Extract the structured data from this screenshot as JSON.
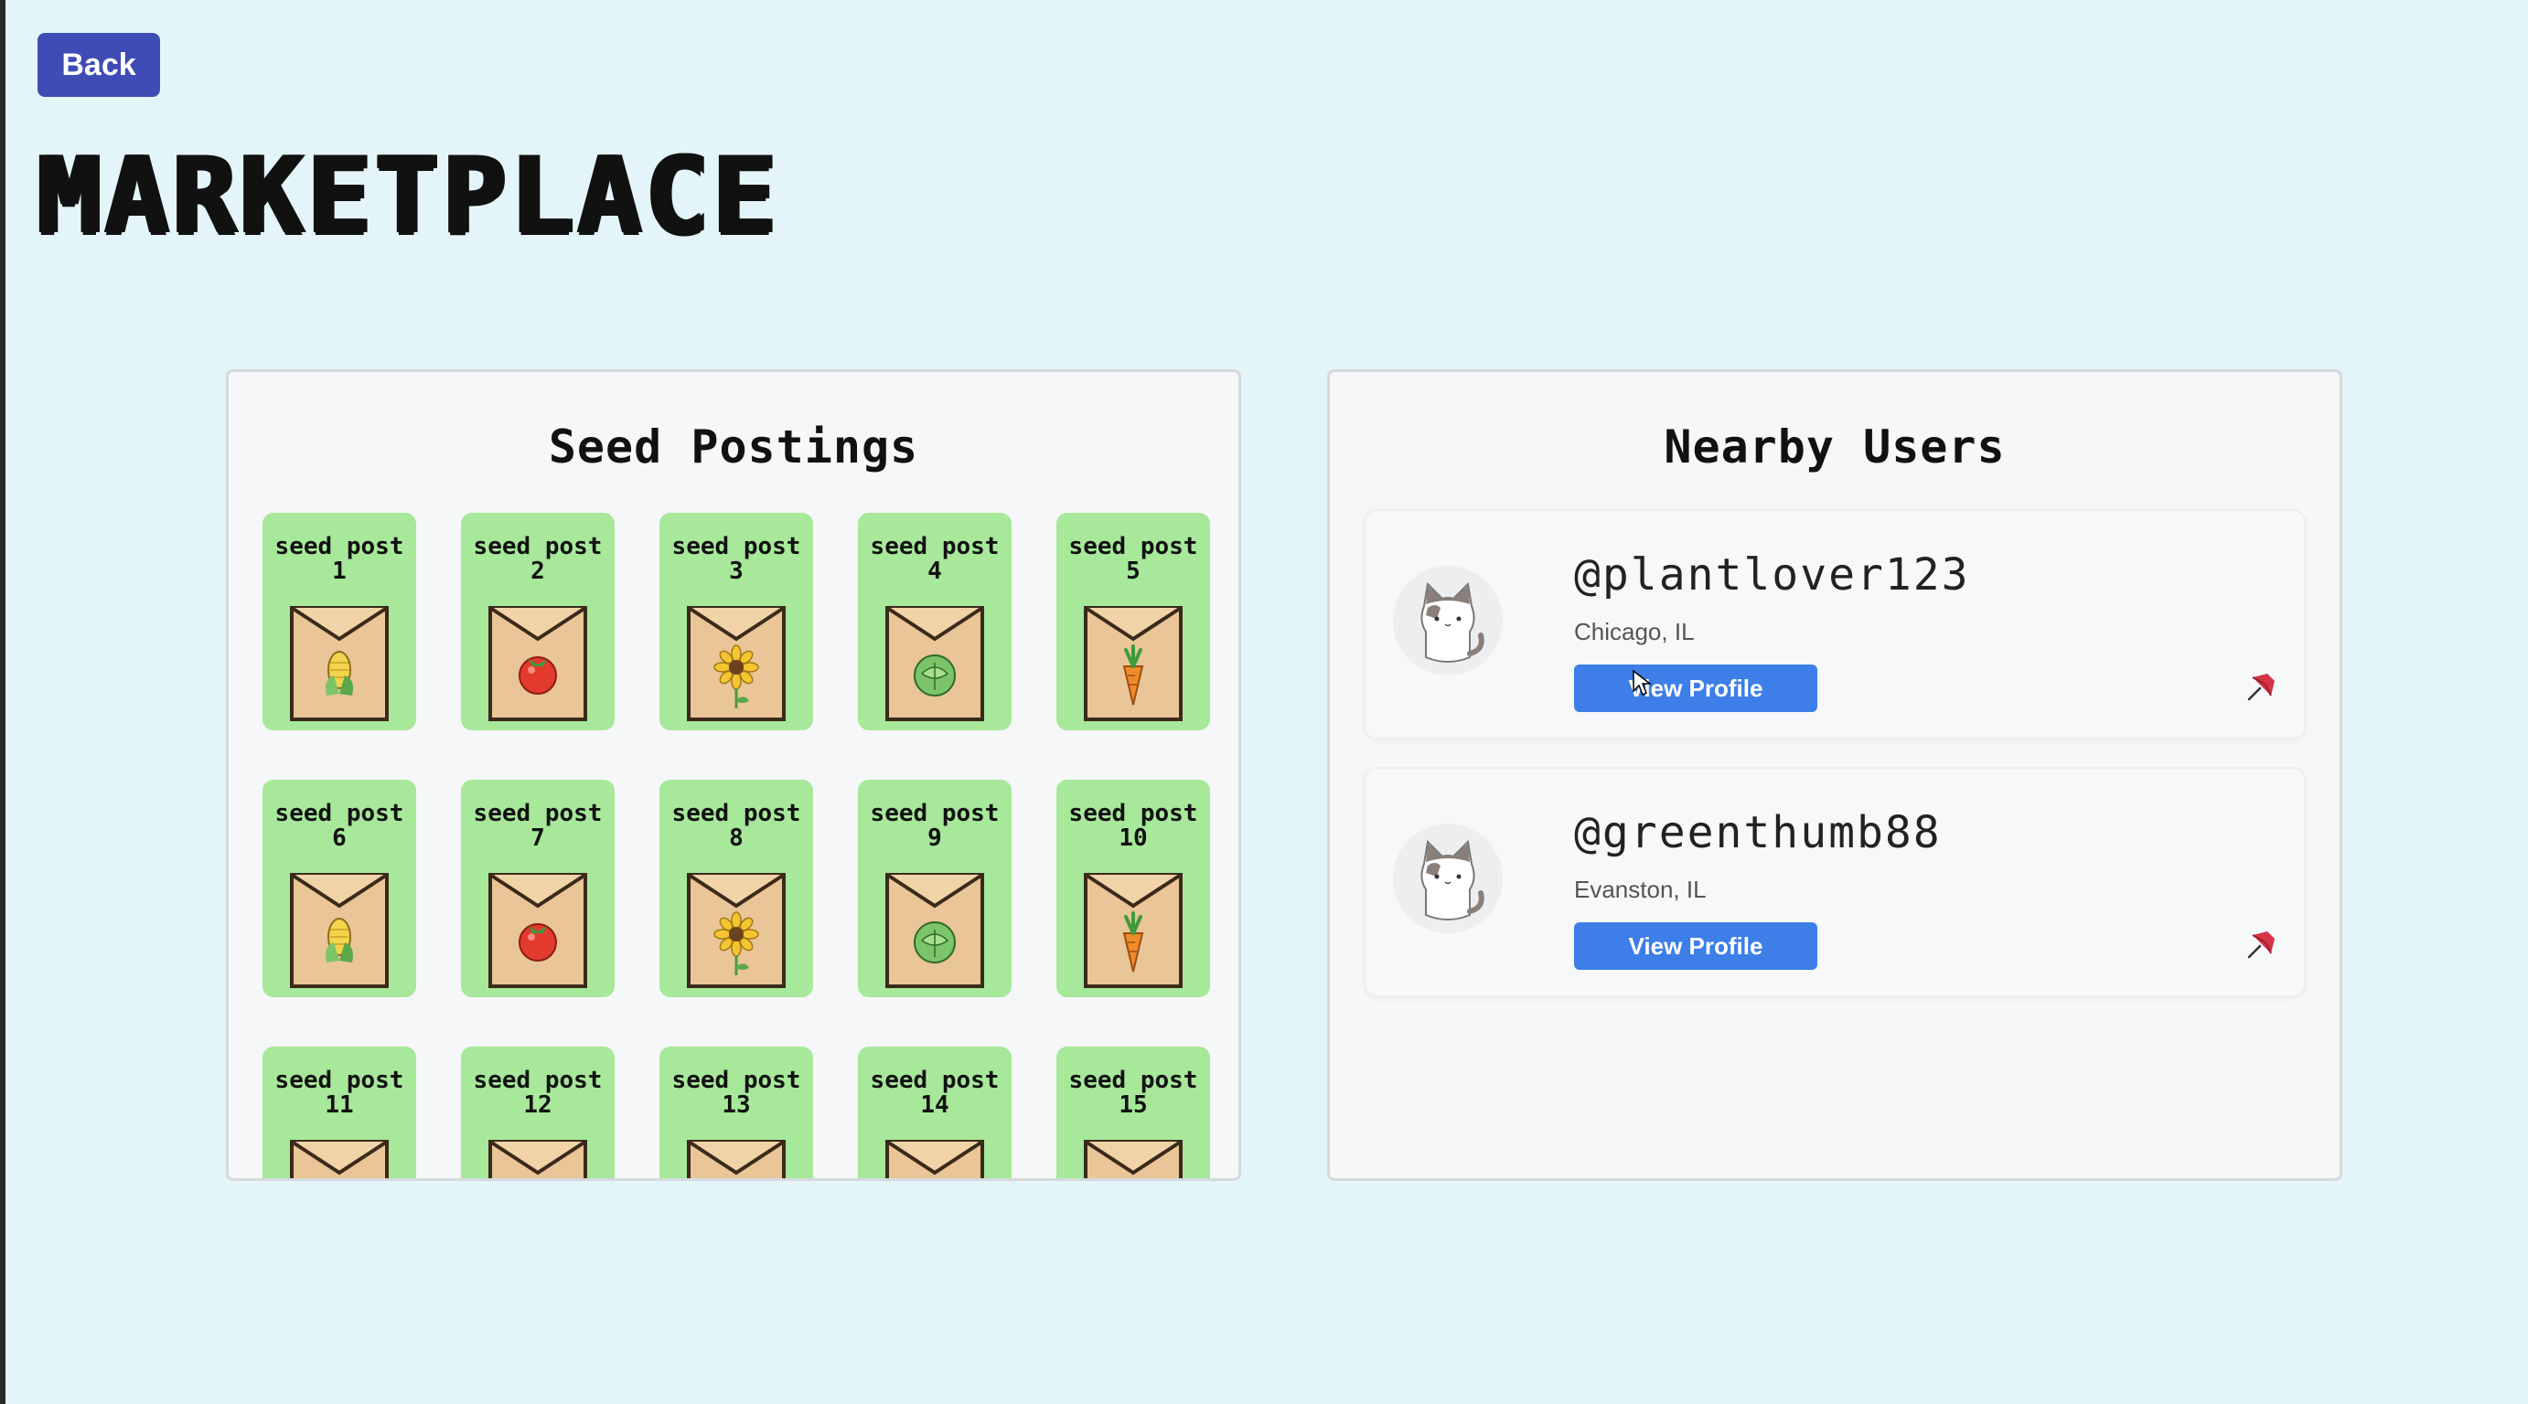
{
  "header": {
    "back_label": "Back",
    "title": "Marketplace"
  },
  "seed_postings": {
    "title": "Seed Postings",
    "card_color": "#a7e89a",
    "items": [
      {
        "label": "seed post 1",
        "icon": "corn-icon"
      },
      {
        "label": "seed post 2",
        "icon": "tomato-icon"
      },
      {
        "label": "seed post 3",
        "icon": "sunflower-icon"
      },
      {
        "label": "seed post 4",
        "icon": "cabbage-icon"
      },
      {
        "label": "seed post 5",
        "icon": "carrot-icon"
      },
      {
        "label": "seed post 6",
        "icon": "corn-icon"
      },
      {
        "label": "seed post 7",
        "icon": "tomato-icon"
      },
      {
        "label": "seed post 8",
        "icon": "sunflower-icon"
      },
      {
        "label": "seed post 9",
        "icon": "cabbage-icon"
      },
      {
        "label": "seed post 10",
        "icon": "carrot-icon"
      },
      {
        "label": "seed post 11",
        "icon": "corn-icon"
      },
      {
        "label": "seed post 12",
        "icon": "tomato-icon"
      },
      {
        "label": "seed post 13",
        "icon": "sunflower-icon"
      },
      {
        "label": "seed post 14",
        "icon": "cabbage-icon"
      },
      {
        "label": "seed post 15",
        "icon": "carrot-icon"
      }
    ]
  },
  "nearby_users": {
    "title": "Nearby Users",
    "button_color": "#3d7ee8",
    "users": [
      {
        "username": "@plantlover123",
        "location": "Chicago, IL",
        "button_label": "View Profile",
        "avatar_icon": "cat-avatar-icon",
        "action_icon": "pin-icon"
      },
      {
        "username": "@greenthumb88",
        "location": "Evanston, IL",
        "button_label": "View Profile",
        "avatar_icon": "cat-avatar-icon",
        "action_icon": "pin-icon"
      }
    ]
  },
  "colors": {
    "background": "#e3f5f9",
    "back_button": "#3f4cb5"
  }
}
